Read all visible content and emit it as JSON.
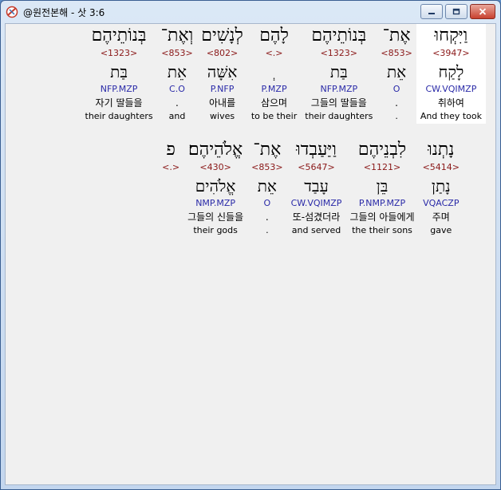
{
  "window": {
    "title": "@원전본해 - 삿 3:6"
  },
  "verse_rows": [
    [
      {
        "heb": "וַיִּקְחוּ",
        "strong": "<3947>",
        "lemma": "לָקַח",
        "morph": "CW.VQIMZP",
        "kor": "취하여",
        "eng": "And they took",
        "highlight": true
      },
      {
        "heb": "אֶת־",
        "strong": "<853>",
        "lemma": "אֵת",
        "morph": "O",
        "kor": ".",
        "eng": "."
      },
      {
        "heb": "בְּנוֹתֵיהֶם",
        "strong": "<1323>",
        "lemma": "בַּת",
        "morph": "NFP.MZP",
        "kor": "그들의 딸들을",
        "eng": "their daughters"
      },
      {
        "heb": "לָהֶם",
        "strong": "<.>",
        "lemma": "ְ",
        "morph": "P.MZP",
        "kor": "삼으며",
        "eng": "to be their"
      },
      {
        "heb": "לְנָשִׁים",
        "strong": "<802>",
        "lemma": "אִשָּׁה",
        "morph": "P.NFP",
        "kor": "아내를",
        "eng": "wives"
      },
      {
        "heb": "וְאֶת־",
        "strong": "<853>",
        "lemma": "אֵת",
        "morph": "C.O",
        "kor": ".",
        "eng": "and"
      },
      {
        "heb": "בְּנוֹתֵיהֶם",
        "strong": "<1323>",
        "lemma": "בַּת",
        "morph": "NFP.MZP",
        "kor": "자기 딸들을",
        "eng": "their daughters"
      }
    ],
    [
      {
        "heb": "נָתְנוּ",
        "strong": "<5414>",
        "lemma": "נָתַן",
        "morph": "VQACZP",
        "kor": "주며",
        "eng": "gave"
      },
      {
        "heb": "לִבְנֵיהֶם",
        "strong": "<1121>",
        "lemma": "בֵּן",
        "morph": "P.NMP.MZP",
        "kor": "그들의 아들에게",
        "eng": "the their sons"
      },
      {
        "heb": "וַיַּעַבְדוּ",
        "strong": "<5647>",
        "lemma": "עָבַד",
        "morph": "CW.VQIMZP",
        "kor": "또-섬겼더라",
        "eng": "and served"
      },
      {
        "heb": "אֶת־",
        "strong": "<853>",
        "lemma": "אֵת",
        "morph": "O",
        "kor": ".",
        "eng": "."
      },
      {
        "heb": "אֱלֹהֵיהֶם׃",
        "strong": "<430>",
        "lemma": "אֱלֹהִים",
        "morph": "NMP.MZP",
        "kor": "그들의 신들을",
        "eng": "their gods"
      },
      {
        "heb": "פ",
        "strong": "<.>",
        "lemma": "",
        "morph": "",
        "kor": "",
        "eng": ""
      }
    ]
  ]
}
